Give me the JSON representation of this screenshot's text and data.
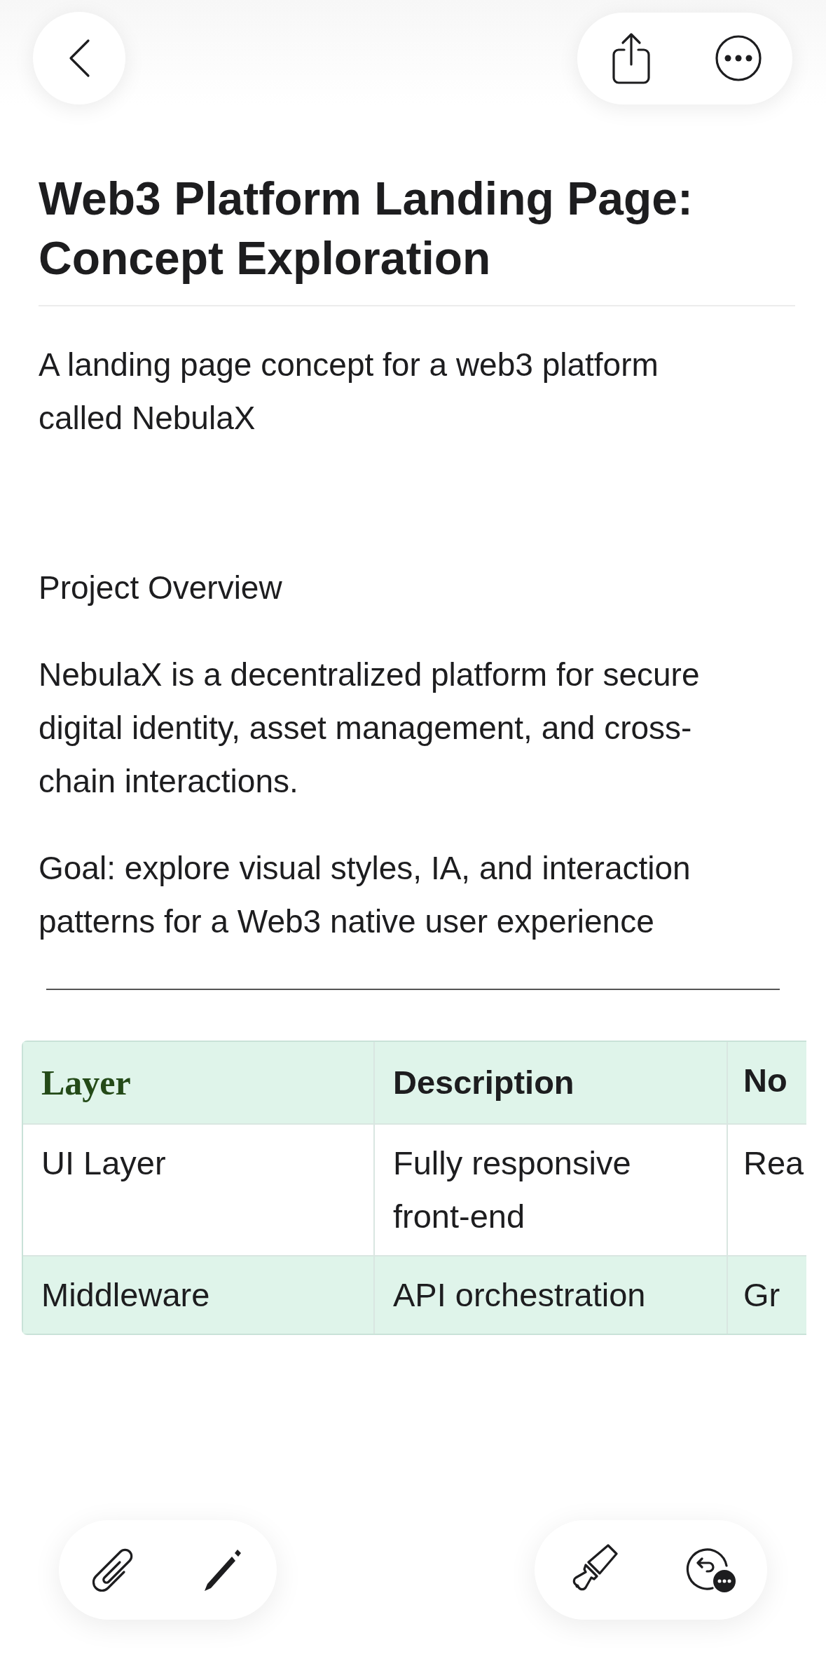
{
  "title": "Web3 Platform Landing Page: Concept Exploration",
  "blocks": [
    {
      "kind": "paragraph",
      "text": "A landing page concept for a web3 platform called NebulaX"
    },
    {
      "kind": "heading",
      "text": "Project Overview"
    },
    {
      "kind": "paragraph",
      "text": "NebulaX is a decentralized platform for secure digital identity, asset management, and cross-chain interactions."
    },
    {
      "kind": "paragraph",
      "text": "Goal: explore visual styles, IA, and interaction patterns for a Web3 native user experience"
    },
    {
      "kind": "rule"
    }
  ],
  "table": {
    "columns": [
      {
        "label": "Layer"
      },
      {
        "label": "Description"
      },
      {
        "label": "No"
      }
    ],
    "rows": [
      {
        "highlighted": false,
        "cells": [
          "UI Layer",
          "Fully responsive front-end",
          "Rea"
        ]
      },
      {
        "highlighted": true,
        "cells": [
          "Middleware",
          "API orchestration",
          "Gr"
        ]
      }
    ]
  }
}
